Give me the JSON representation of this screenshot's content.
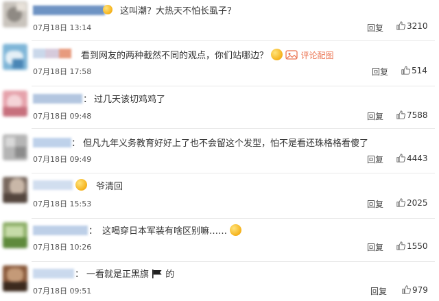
{
  "comments": [
    {
      "text": "这叫潮？大热天不怕长虱子？",
      "time": "07月18日 13:14",
      "reply": "回复",
      "likes": "3210",
      "avatar": [
        "#c9c4bd",
        "#8f8a84",
        "#e8e2da"
      ],
      "name_color": "#3e6fb0",
      "emoji_before": "smile-emoji-icon"
    },
    {
      "text": "看到网友的两种截然不同的观点，你们站哪边？",
      "link": "评论配图",
      "time": "07月18日 17:58",
      "reply": "回复",
      "likes": "514",
      "avatar": [
        "#7fb6d8",
        "#e5f0f7",
        "#4a86b6"
      ],
      "name_color": "#e07a54",
      "emoji_after": "tongue-emoji-icon"
    },
    {
      "text": "过几天该切鸡鸡了",
      "time": "07月18日 09:48",
      "reply": "回复",
      "likes": "7588",
      "avatar": [
        "#e6a3ac",
        "#f5d4d8",
        "#c7707d"
      ],
      "name_color": "#9ab4d6"
    },
    {
      "text": "但凡九年义务教育好好上了也不会留这个发型，怕不是看还珠格格看傻了",
      "time": "07月18日 09:49",
      "reply": "回复",
      "likes": "4443",
      "avatar": [
        "#b5b5b5",
        "#d9d9d9",
        "#8c8c8c"
      ],
      "name_color": "#a9c2e4"
    },
    {
      "text": "爷清回",
      "time": "07月18日 15:53",
      "reply": "回复",
      "likes": "2025",
      "avatar": [
        "#7a6a60",
        "#c9b7a8",
        "#54463e"
      ],
      "name_color": "#c2d3ea",
      "emoji_before": "blush-emoji-icon"
    },
    {
      "text": "这喝穿日本军装有啥区别嘛……",
      "time": "07月18日 10:26",
      "reply": "回复",
      "likes": "1550",
      "avatar": [
        "#8fb06a",
        "#c6dba8",
        "#5f8a3c"
      ],
      "name_color": "#a7bfe0",
      "emoji_after": "dizzy-emoji-icon"
    },
    {
      "text": "一看就是正黑旗",
      "text_after": "的",
      "time": "07月18日 09:51",
      "reply": "回复",
      "likes": "979",
      "avatar": [
        "#8a5a3c",
        "#c49a78",
        "#3c2a1e"
      ],
      "name_color": "#b9cde8",
      "flag": "black-flag-icon"
    }
  ]
}
